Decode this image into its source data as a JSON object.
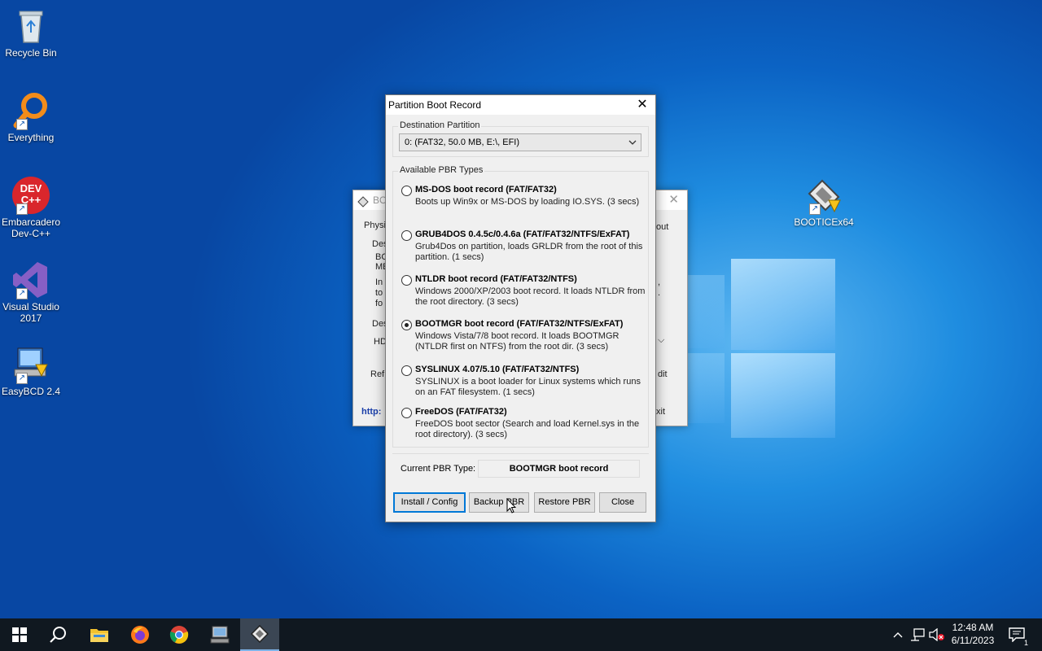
{
  "desktop_icons": [
    {
      "label": "Recycle Bin",
      "icon": "recycle-bin-icon"
    },
    {
      "label": "Everything",
      "icon": "magnifier-icon"
    },
    {
      "label": "Embarcadero Dev-C++",
      "icon": "devcpp-icon",
      "logo_text": "DEV C++"
    },
    {
      "label": "Visual Studio 2017",
      "icon": "visual-studio-icon"
    },
    {
      "label": "EasyBCD 2.4",
      "icon": "easybcd-icon"
    },
    {
      "label": "BOOTICEx64",
      "icon": "bootice-icon"
    }
  ],
  "background_window": {
    "title": "BO",
    "fragments": {
      "tab": "Physi",
      "tab_right": "out",
      "group_lbl": "Des",
      "line1": "BO",
      "line2": "ME",
      "line3": "In",
      "line4": "to",
      "line5": "fo",
      "comma": ",",
      "dot": ".",
      "dest_lbl": "Des",
      "dest_val": "HD",
      "refresh": "Ref",
      "edit": "dit",
      "link": "http:",
      "exit": "xit"
    }
  },
  "dialog": {
    "title": "Partition Boot Record",
    "close_glyph": "✕",
    "destination_label": "Destination Partition",
    "destination_value": "0: (FAT32,  50.0 MB, E:\\, EFI)",
    "types_label": "Available PBR Types",
    "options": [
      {
        "name": "MS-DOS boot record (FAT/FAT32)",
        "desc": "Boots up Win9x or MS-DOS by loading IO.SYS. (3 secs)",
        "selected": false
      },
      {
        "name": "GRUB4DOS 0.4.5c/0.4.6a (FAT/FAT32/NTFS/ExFAT)",
        "desc": "Grub4Dos on partition, loads GRLDR from the root of this partition. (1 secs)",
        "selected": false
      },
      {
        "name": "NTLDR boot record (FAT/FAT32/NTFS)",
        "desc": "Windows 2000/XP/2003 boot record. It loads NTLDR from the root directory. (3 secs)",
        "selected": false
      },
      {
        "name": "BOOTMGR boot record (FAT/FAT32/NTFS/ExFAT)",
        "desc": "Windows Vista/7/8 boot record. It loads BOOTMGR (NTLDR first on NTFS) from the root dir. (3 secs)",
        "selected": true
      },
      {
        "name": "SYSLINUX 4.07/5.10 (FAT/FAT32/NTFS)",
        "desc": "SYSLINUX is a boot loader for Linux systems which runs on an FAT filesystem. (1 secs)",
        "selected": false
      },
      {
        "name": "FreeDOS (FAT/FAT32)",
        "desc": "FreeDOS boot sector (Search and load Kernel.sys in the root directory). (3 secs)",
        "selected": false
      }
    ],
    "current_label": "Current PBR Type:",
    "current_value": "BOOTMGR boot record",
    "buttons": {
      "install": "Install / Config",
      "backup": "Backup PBR",
      "restore": "Restore PBR",
      "close": "Close"
    }
  },
  "taskbar": {
    "items": [
      "start-icon",
      "search-icon",
      "file-explorer-icon",
      "firefox-icon",
      "chrome-icon",
      "easybcd-taskbar-icon",
      "bootice-taskbar-icon"
    ],
    "tray": {
      "chevron": "^",
      "network": "network-icon",
      "volume": "volume-muted-icon"
    },
    "time": "12:48 AM",
    "date": "6/11/2023",
    "notifications_count": "1"
  }
}
